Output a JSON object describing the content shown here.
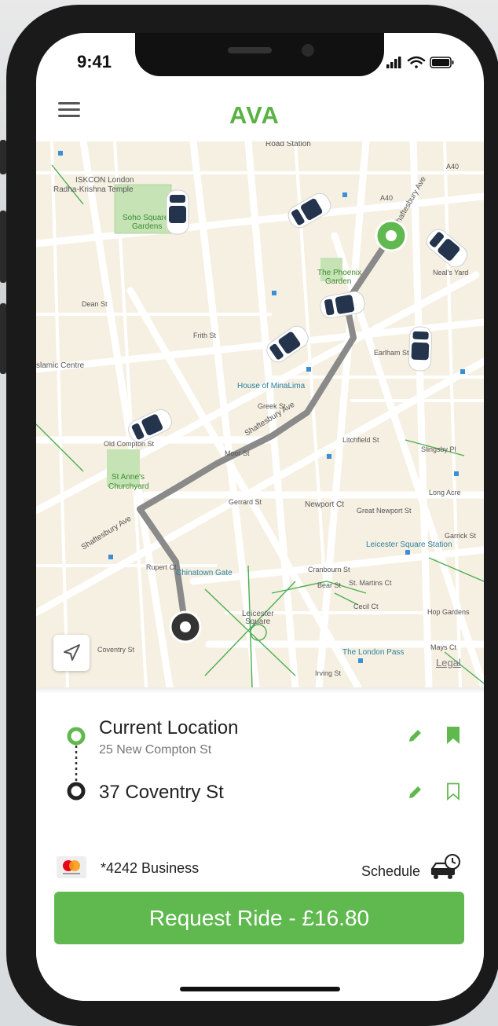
{
  "status_bar": {
    "time": "9:41"
  },
  "header": {
    "logo": "AVA",
    "menu_icon": "hamburger-menu-icon"
  },
  "map": {
    "labels": {
      "road_station": "Road Station",
      "iskcon": "ISKCON London",
      "radha": "Radha-Krishna Temple",
      "soho_square": "Soho Square",
      "gardens": "Gardens",
      "phoenix": "The Phoenix",
      "phoenix_garden": "Garden",
      "house_minalima": "House of MinaLima",
      "islamic_centre": "slamic Centre",
      "st_annes": "St Anne's",
      "churchyard": "Churchyard",
      "chinatown_gate": "Chinatown Gate",
      "leicester": "Leicester",
      "square": "Square",
      "leicester_station": "Leicester Square Station",
      "london_pass": "The London Pass",
      "newport_ct": "Newport Ct",
      "great_newport": "Great Newport St",
      "shaftesbury_ave": "Shaftesbury Ave",
      "litchfield": "Litchfield St",
      "gerrard": "Gerrard St",
      "coventry": "Coventry St",
      "st_martins": "St. Martins Ct",
      "cecil": "Cecil Ct",
      "hop_gardens": "Hop Gardens",
      "mays_ct": "Mays Ct",
      "a40": "A40",
      "a40b": "A40",
      "earlham": "Earlham St",
      "neals_yard": "Neal's Yard",
      "slingsby": "Slingsby Pl",
      "long_acre": "Long Acre",
      "garrick": "Garrick St",
      "rupert": "Rupert Ct",
      "cranbourn": "Cranbourn St",
      "bear": "Bear St",
      "irving": "Irving St",
      "old_compton": "Old Compton St",
      "dean": "Dean St",
      "greek": "Greek St",
      "frith": "Frith St",
      "moor": "Moor St"
    },
    "legal": "Legal",
    "locate_icon": "navigation-arrow-icon"
  },
  "trip": {
    "pickup": {
      "title": "Current Location",
      "subtitle": "25 New Compton St",
      "saved": true
    },
    "dropoff": {
      "title": "37 Coventry St",
      "saved": false
    }
  },
  "payment": {
    "card_icon": "mastercard-icon",
    "label": "*4242 Business"
  },
  "schedule": {
    "label": "Schedule",
    "icon": "car-clock-icon"
  },
  "request_button": {
    "label": "Request Ride - £16.80"
  },
  "colors": {
    "accent": "#5fb94e",
    "brand": "#5bb244",
    "route": "#8a8a8a"
  }
}
